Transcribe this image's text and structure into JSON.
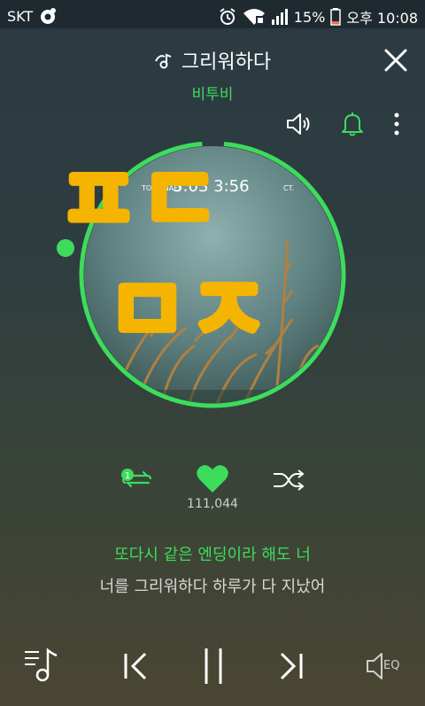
{
  "status_bar": {
    "carrier": "SKT",
    "battery": "15%",
    "time": "오후 10:08"
  },
  "song": {
    "title": "그리워하다",
    "artist": "비투비"
  },
  "album_art": {
    "sticker_text_1": "ㅍㄷ",
    "sticker_text_2": "ㅁㅈ",
    "clock_overlay": "3:03 3:56",
    "progress_fraction": 0.97
  },
  "like": {
    "count": "111,044"
  },
  "lyrics": {
    "current": "또다시 같은 엔딩이라 해도 너",
    "next": "너를 그리워하다 하루가 다 지났어"
  },
  "controls": {
    "eq_label": "EQ",
    "repeat_badge": "1"
  },
  "colors": {
    "accent": "#3ddc5c",
    "sticker": "#f5b400"
  }
}
